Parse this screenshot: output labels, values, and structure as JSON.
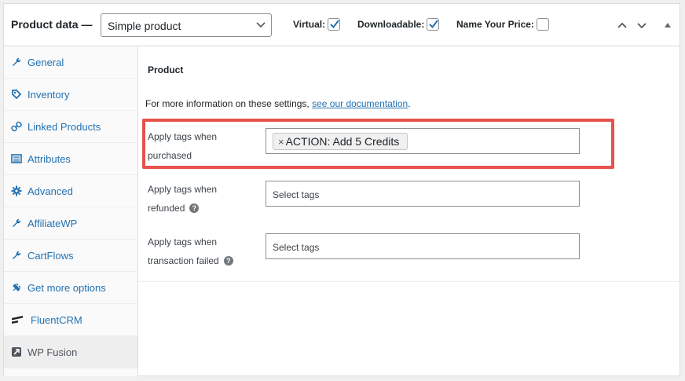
{
  "header": {
    "title": "Product data —",
    "product_type": "Simple product",
    "checkboxes": [
      {
        "label": "Virtual:",
        "checked": true
      },
      {
        "label": "Downloadable:",
        "checked": true
      },
      {
        "label": "Name Your Price:",
        "checked": false
      }
    ],
    "controls": [
      "chevron-up-icon",
      "chevron-down-icon",
      "collapse-triangle-icon"
    ]
  },
  "sidebar": {
    "tabs": [
      {
        "label": "General",
        "icon": "wrench-icon"
      },
      {
        "label": "Inventory",
        "icon": "tag-icon"
      },
      {
        "label": "Linked Products",
        "icon": "link-icon"
      },
      {
        "label": "Attributes",
        "icon": "list-icon"
      },
      {
        "label": "Advanced",
        "icon": "gear-icon"
      },
      {
        "label": "AffiliateWP",
        "icon": "wrench-icon"
      },
      {
        "label": "CartFlows",
        "icon": "wrench-icon"
      },
      {
        "label": "Get more options",
        "icon": "plugin-icon"
      },
      {
        "label": "FluentCRM",
        "icon": "fluentcrm-icon"
      },
      {
        "label": "WP Fusion",
        "icon": "wpfusion-icon",
        "active": true
      }
    ]
  },
  "main": {
    "heading": "Product",
    "info_text": "For more information on these settings,",
    "info_link": "see our documentation",
    "info_suffix": ".",
    "rows": [
      {
        "label_line1": "Apply tags when",
        "label_line2": "purchased",
        "tags": [
          "ACTION: Add 5 Credits"
        ],
        "remove_glyph": "×",
        "placeholder": ""
      },
      {
        "label_line1": "Apply tags when",
        "label_line2": "refunded",
        "help": "?",
        "placeholder": "Select tags"
      },
      {
        "label_line1": "Apply tags when",
        "label_line2": "transaction failed",
        "help": "?",
        "placeholder": "Select tags"
      }
    ]
  },
  "colors": {
    "link": "#2271b1",
    "highlight": "#e5534b",
    "checkbox_accent": "#2271b1"
  }
}
